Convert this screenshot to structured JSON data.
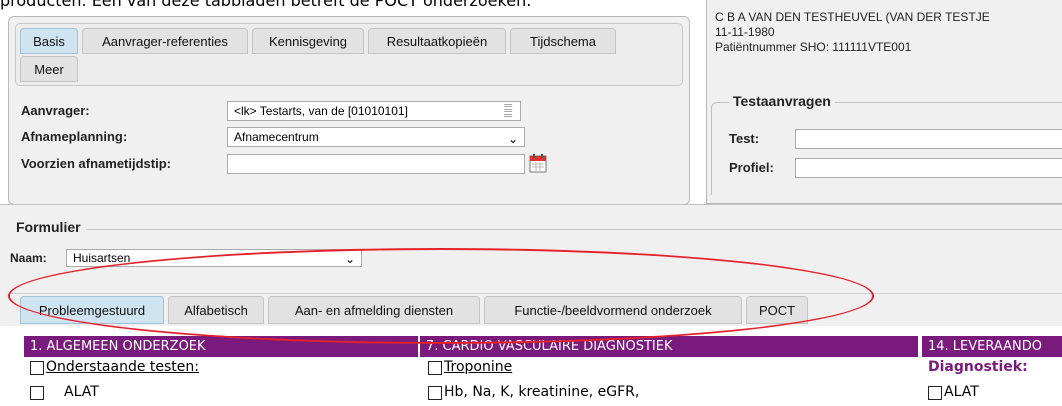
{
  "caption": "producten. Een van deze tabbladen betreft de POCT onderzoeken.",
  "top_tabs": [
    {
      "label": "Basis",
      "active": true
    },
    {
      "label": "Aanvrager-referenties"
    },
    {
      "label": "Kennisgeving"
    },
    {
      "label": "Resultaatkopieën"
    },
    {
      "label": "Tijdschema"
    },
    {
      "label": "Meer"
    }
  ],
  "fields": {
    "aanvrager_label": "Aanvrager:",
    "aanvrager_value": "<lk> Testarts, van de [01010101]",
    "afnameplanning_label": "Afnameplanning:",
    "afnameplanning_value": "Afnamecentrum",
    "afnametijdstip_label": "Voorzien afnametijdstip:",
    "afnametijdstip_value": ""
  },
  "patient": {
    "name": "C B A VAN DEN TESTHEUVEL (VAN DER TESTJE",
    "dob": "11-11-1980",
    "number": "Patiëntnummer SHO: 111111VTE001"
  },
  "testaanvragen": {
    "legend": "Testaanvragen",
    "test_label": "Test:",
    "profiel_label": "Profiel:"
  },
  "formulier": {
    "legend": "Formulier",
    "naam_label": "Naam:",
    "naam_value": "Huisartsen"
  },
  "form_tabs": [
    {
      "label": "Probleemgestuurd",
      "active": true
    },
    {
      "label": "Alfabetisch"
    },
    {
      "label": "Aan- en afmelding diensten"
    },
    {
      "label": "Functie-/beeldvormend onderzoek"
    },
    {
      "label": "POCT"
    }
  ],
  "columns": {
    "col1_header": "1. ALGEMEEN ONDERZOEK",
    "col1_item1": "Onderstaande testen:",
    "col1_item2": "ALAT",
    "col2_header": "7. CARDIO VASCULAIRE DIAGNOSTIEK",
    "col2_item1": "Troponine",
    "col2_item2": "Hb, Na, K, kreatinine, eGFR,",
    "col3_header": "14. LEVERAANDO",
    "col3_item1": "Diagnostiek:",
    "col3_item2": "ALAT"
  },
  "colors": {
    "header_purple": "#7a1a7c",
    "annotation_red": "#e3212a",
    "active_tab": "#cfe4f1"
  }
}
